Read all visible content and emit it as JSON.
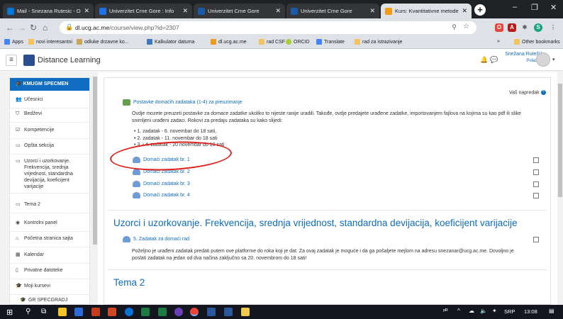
{
  "browser": {
    "tabs": [
      {
        "label": "Mail - Snezana Rutesic - Ou",
        "color": "#0078d4"
      },
      {
        "label": "Univerzitet Crne Gore : Info",
        "color": "#1a73e8"
      },
      {
        "label": "Univerzitet Crne Gore",
        "color": "#1a5aa6"
      },
      {
        "label": "Univerzitet Crne Gore",
        "color": "#1a5aa6"
      },
      {
        "label": "Kurs: Kvantitativne metode",
        "color": "#f39c12"
      }
    ],
    "url_domain": "dl.ucg.ac.me",
    "url_path": "/course/view.php?id=2307",
    "bookmarks": [
      "Apps",
      "novi interesantni",
      "odluke drzavne ko...",
      "Kalkulator datuma",
      "dl.ucg.ac.me",
      "rad CSF",
      "ORCID",
      "Translate",
      "rad za istrazivanje"
    ],
    "other_bookmarks": "Other bookmarks",
    "more": "»"
  },
  "site": {
    "name": "Distance Learning",
    "user_name": "Snežana Rutešić",
    "user_role": "Polaznik"
  },
  "sidebar": {
    "course": "KMUGM SPECMEN",
    "items": [
      {
        "label": "Učesnici",
        "icon": "users-icon",
        "glyph": "👥"
      },
      {
        "label": "Bedževi",
        "icon": "badge-icon",
        "glyph": "⛉"
      },
      {
        "label": "Kompetencije",
        "icon": "competency-icon",
        "glyph": "☑"
      },
      {
        "label": "Opšta sekcija",
        "icon": "folder-icon",
        "glyph": "▭"
      },
      {
        "label": "Uzorci i uzorkovanje. Frekvencija, srednja vrijednost, standardna devijacija, koeficijent varijacije",
        "icon": "folder-icon",
        "glyph": "▭"
      },
      {
        "label": "Tema 2",
        "icon": "folder-icon",
        "glyph": "▭"
      },
      {
        "label": "Kontrolni panel",
        "icon": "dashboard-icon",
        "glyph": "◉"
      },
      {
        "label": "Početna stranica sajta",
        "icon": "home-icon",
        "glyph": "⌂"
      },
      {
        "label": "Kalendar",
        "icon": "calendar-icon",
        "glyph": "▦"
      },
      {
        "label": "Privatne datoteke",
        "icon": "file-icon",
        "glyph": "▯"
      },
      {
        "label": "Moji kursevi",
        "icon": "graduation-icon",
        "glyph": "🎓"
      },
      {
        "label": "GR SPECGRADJ",
        "icon": "graduation-icon",
        "glyph": "🎓"
      }
    ]
  },
  "main": {
    "progress_label": "Vaš napredak",
    "forum_title": "Postavke domaćih zadataka (1-4) za preuzimanje",
    "intro": "Ovdje mozete preuzeti postavke za domace zadatke ukoliko to nijeste ranije uradili. Takođe, ovdje predajete urađene zadatke, importovanjem fajlova na kojima su kao pdf ili slike snimljeni urađeni zadaci. Rokovi za predaju zadataka su kako slijedi:",
    "deadlines": [
      "1. zadatak - 6. novembar do 18 sati,",
      "2. zadatak -  11. novembar do 18 sati",
      "3. i 4. zadatak  - 20 novembar do 18 sati"
    ],
    "assignments": [
      "Domaći zadatak br. 1",
      "Domaći zadatak br. 2",
      "Domaći zadatak br. 3",
      "Domaći zadatak br. 4"
    ],
    "section2_title": "Uzorci i uzorkovanje. Frekvencija, srednja vrijednost, standardna devijacija, koeficijent varijacije",
    "section2_activity": "5. Zadatak za domaći rad",
    "section2_text": "Poželjno je urađeni zadatak predati putem ove platforme do roka koji je dat. Za ovaj zadatak je moguće i da ga pošaljete mejlom na adresu snezanar@ucg.ac.me. Dovoljno je poslati zadatak na jedan od dva načina zaključno sa 20. novembrom do 18 sati!",
    "section3_title": "Tema 2"
  },
  "taskbar": {
    "lang": "SRP",
    "time": "13:08"
  }
}
